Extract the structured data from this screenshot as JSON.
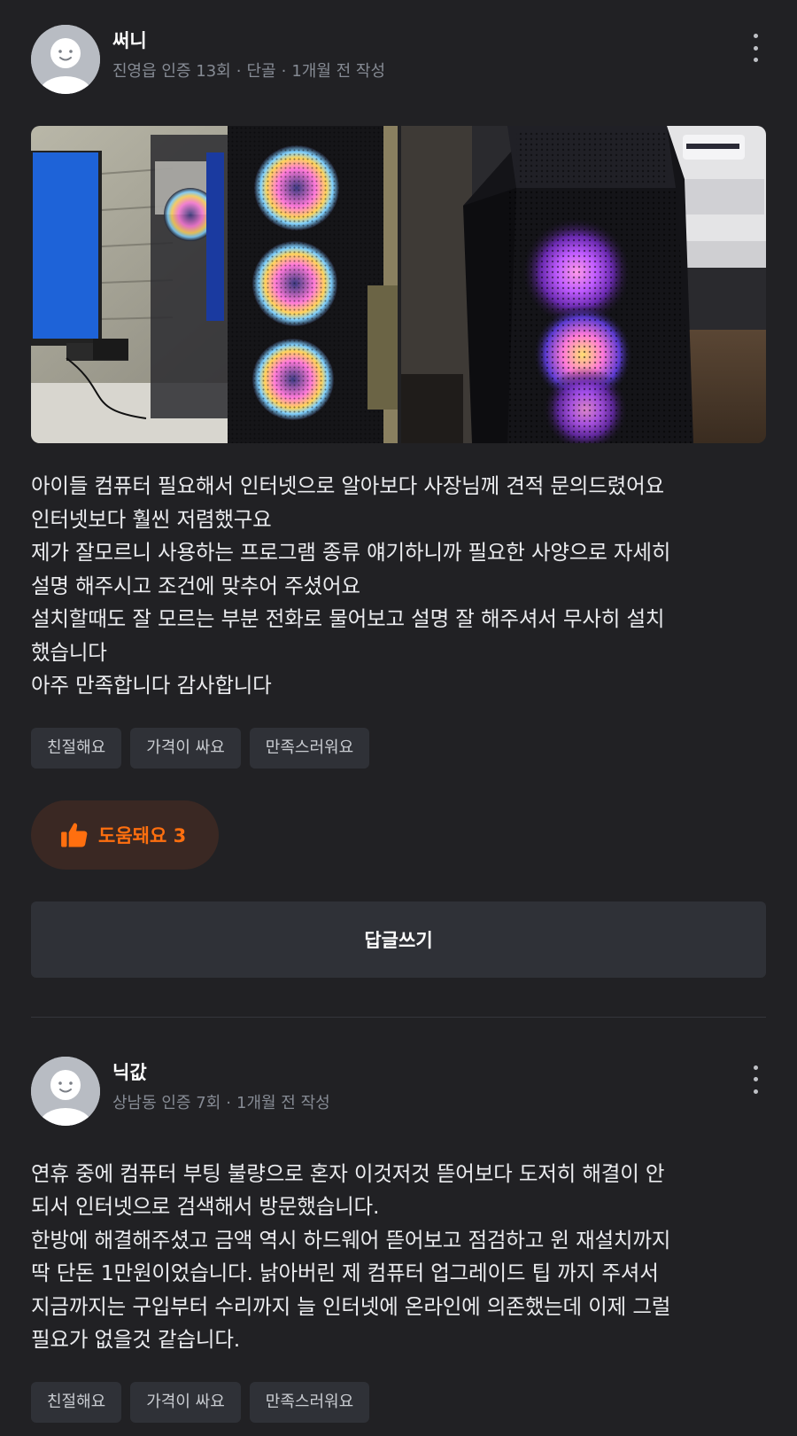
{
  "reviews": [
    {
      "author": "써니",
      "meta": {
        "location_verification": "진영읍 인증 13회",
        "badge": "단골",
        "time": "1개월 전 작성"
      },
      "photos": [
        {
          "icon": "gaming-pc-photo"
        },
        {
          "icon": "gaming-pc-case-photo"
        }
      ],
      "body": [
        "아이들 컴퓨터 필요해서 인터넷으로 알아보다 사장님께 견적 문의드렸어요",
        "인터넷보다 훨씬 저렴했구요",
        "제가 잘모르니 사용하는 프로그램 종류 얘기하니까 필요한 사양으로 자세히",
        "설명 해주시고 조건에 맞추어 주셨어요",
        "설치할때도 잘 모르는 부분 전화로 물어보고 설명 잘 해주셔서 무사히 설치",
        "했습니다",
        "아주 만족합니다 감사합니다"
      ],
      "tags": [
        "친절해요",
        "가격이 싸요",
        "만족스러워요"
      ],
      "helpful": {
        "label": "도움돼요 3",
        "color": "#ff6f0f",
        "icon": "thumbs-up-icon"
      },
      "reply_label": "답글쓰기"
    },
    {
      "author": "닉값",
      "meta": {
        "location_verification": "상남동 인증 7회",
        "time": "1개월 전 작성"
      },
      "body": [
        "연휴 중에 컴퓨터 부팅 불량으로 혼자 이것저것 뜯어보다 도저히 해결이 안",
        "되서 인터넷으로 검색해서 방문했습니다.",
        "한방에 해결해주셨고 금액 역시 하드웨어 뜯어보고 점검하고 윈 재설치까지",
        "딱 단돈 1만원이었습니다. 낡아버린 제 컴퓨터 업그레이드 팁 까지 주셔서",
        "지금까지는 구입부터 수리까지 늘 인터넷에 온라인에 의존했는데 이제 그럴",
        "필요가 없을것 같습니다."
      ],
      "tags": [
        "친절해요",
        "가격이 싸요",
        "만족스러워요"
      ]
    }
  ],
  "colors": {
    "background": "#212124",
    "accent": "#ff6f0f",
    "tag_background": "#2f3137",
    "meta_text": "#868b94"
  }
}
